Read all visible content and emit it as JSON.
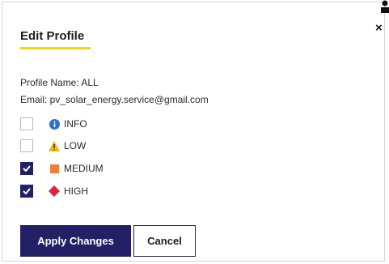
{
  "dialog": {
    "title": "Edit Profile",
    "close_glyph": "×",
    "profile_name_line": "Profile Name: ALL",
    "email_line": "Email: pv_solar_energy.service@gmail.com"
  },
  "severities": [
    {
      "label": "INFO",
      "checked": false,
      "icon": "info-circle-icon",
      "color": "#2f6fd4"
    },
    {
      "label": "LOW",
      "checked": false,
      "icon": "warning-triangle-icon",
      "color": "#f2b705"
    },
    {
      "label": "MEDIUM",
      "checked": true,
      "icon": "square-icon",
      "color": "#f07f35"
    },
    {
      "label": "HIGH",
      "checked": true,
      "icon": "diamond-icon",
      "color": "#d7263d"
    }
  ],
  "buttons": {
    "apply": "Apply Changes",
    "cancel": "Cancel"
  },
  "colors": {
    "primary": "#232066",
    "accent_underline": "#f5d50a"
  }
}
